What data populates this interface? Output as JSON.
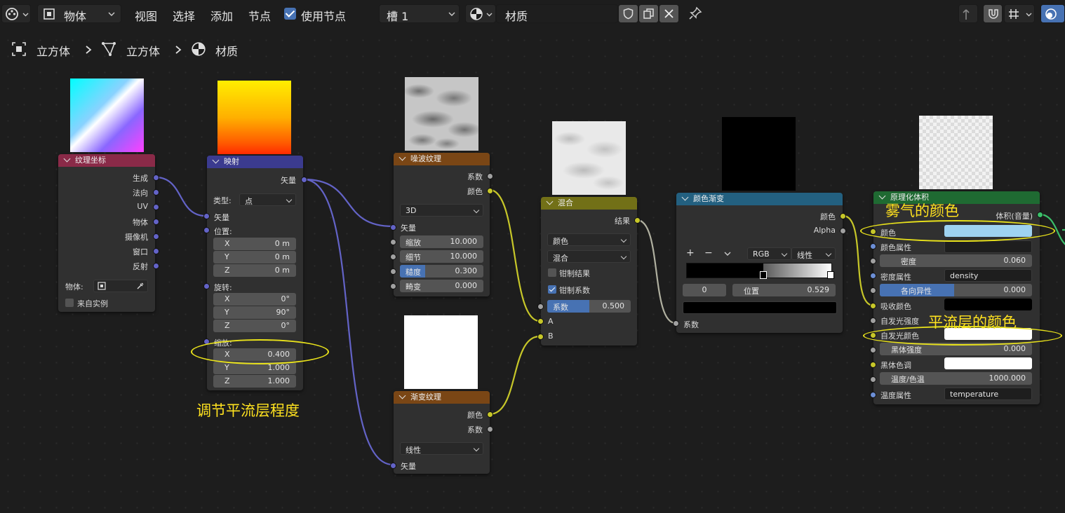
{
  "header": {
    "mode": "物体",
    "menus": [
      "视图",
      "选择",
      "添加",
      "节点"
    ],
    "use_nodes_label": "使用节点",
    "slot": "槽 1",
    "material_name": "材质"
  },
  "breadcrumb": [
    "立方体",
    "立方体",
    "材质"
  ],
  "nodes": {
    "texcoord": {
      "title": "纹理坐标",
      "outputs": [
        "生成",
        "法向",
        "UV",
        "物体",
        "摄像机",
        "窗口",
        "反射"
      ],
      "object_label": "物体:",
      "from_instancer": "来自实例"
    },
    "mapping": {
      "title": "映射",
      "output": "矢量",
      "type_label": "类型:",
      "type_value": "点",
      "vector_input": "矢量",
      "location_label": "位置:",
      "location": [
        [
          "X",
          "0 m"
        ],
        [
          "Y",
          "0 m"
        ],
        [
          "Z",
          "0 m"
        ]
      ],
      "rotation_label": "旋转:",
      "rotation": [
        [
          "X",
          "0°"
        ],
        [
          "Y",
          "90°"
        ],
        [
          "Z",
          "0°"
        ]
      ],
      "scale_label": "缩放:",
      "scale": [
        [
          "X",
          "0.400"
        ],
        [
          "Y",
          "1.000"
        ],
        [
          "Z",
          "1.000"
        ]
      ]
    },
    "noise": {
      "title": "噪波纹理",
      "outputs": [
        "系数",
        "颜色"
      ],
      "dimension": "3D",
      "vector_input": "矢量",
      "fields": [
        [
          "缩放",
          "10.000"
        ],
        [
          "细节",
          "10.000"
        ],
        [
          "糙度",
          "0.300"
        ],
        [
          "畸变",
          "0.000"
        ]
      ],
      "roughness_fill": 0.3
    },
    "gradient": {
      "title": "渐变纹理",
      "outputs": [
        "颜色",
        "系数"
      ],
      "type": "线性",
      "vector_input": "矢量"
    },
    "mix": {
      "title": "混合",
      "output": "结果",
      "data_type": "颜色",
      "blend": "混合",
      "clamp_result": "钳制结果",
      "clamp_factor": "钳制系数",
      "factor_label": "系数",
      "factor_value": "0.500",
      "factor_fill": 0.5,
      "input_a": "A",
      "input_b": "B"
    },
    "colorramp": {
      "title": "颜色渐变",
      "outputs": [
        "颜色",
        "Alpha"
      ],
      "plus": "+",
      "minus": "−",
      "color_mode": "RGB",
      "interpolation": "线性",
      "index": "0",
      "pos_label": "位置",
      "pos_value": "0.529",
      "stop_position": 0.529,
      "input": "系数"
    },
    "volume": {
      "title": "原理化体积",
      "output": "体积(音量)",
      "rows": [
        {
          "label": "颜色",
          "value": ""
        },
        {
          "label": "颜色属性",
          "value": ""
        },
        {
          "label": "密度",
          "value": "0.060"
        },
        {
          "label": "密度属性",
          "value": "density"
        },
        {
          "label": "各向异性",
          "value": "0.000"
        },
        {
          "label": "吸收颜色",
          "value": ""
        },
        {
          "label": "自发光强度",
          "value": ""
        },
        {
          "label": "自发光颜色",
          "value": ""
        },
        {
          "label": "黑体强度",
          "value": "0.000"
        },
        {
          "label": "黑体色调",
          "value": ""
        },
        {
          "label": "温度/色温",
          "value": "1000.000"
        },
        {
          "label": "温度属性",
          "value": "temperature"
        }
      ],
      "colors": {
        "color": "#9ed2f0",
        "absorption": "#000000",
        "emission": "#ffffff",
        "blackbody_tint": "#ffffff"
      }
    }
  },
  "annotations": {
    "fog_color": "雾气的颜色",
    "stratosphere_color": "平流层的颜色",
    "adjust_level": "调节平流层程度"
  },
  "colors": {
    "header_texture": "#8a2a48",
    "header_vector": "#3b3b8f",
    "header_texnode": "#7a4615",
    "header_color": "#727017",
    "header_converter": "#236080",
    "header_shader": "#1f6a32",
    "annotation": "#ffe21f"
  }
}
